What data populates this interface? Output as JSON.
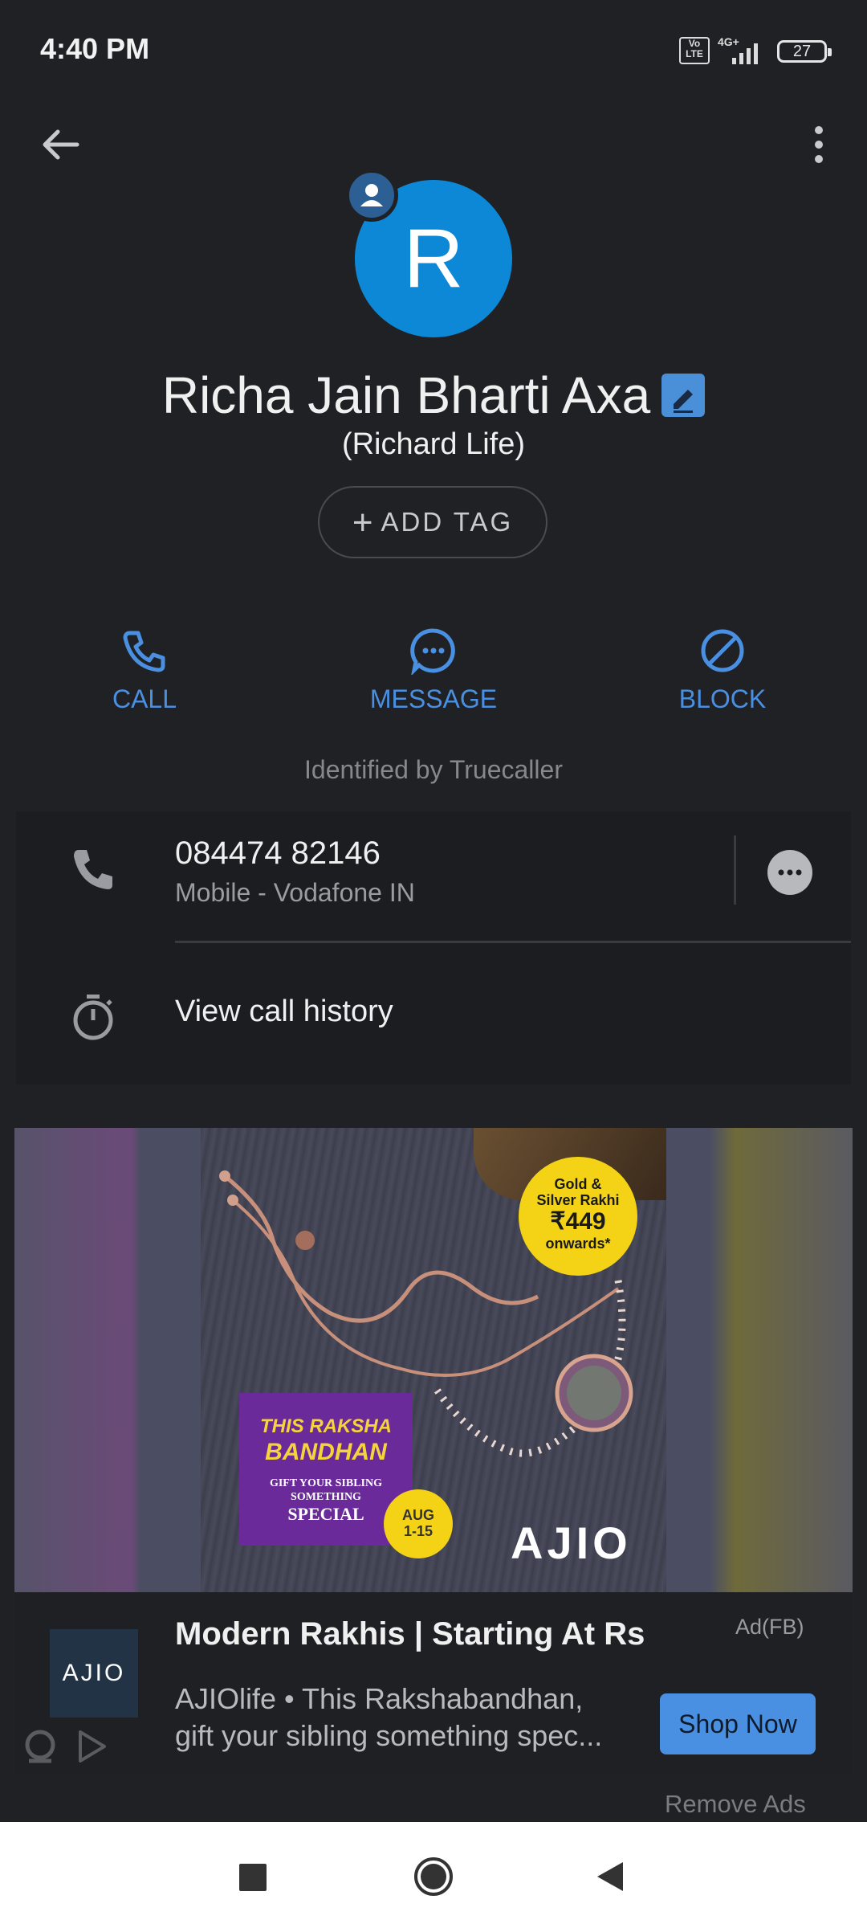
{
  "status_bar": {
    "time": "4:40 PM",
    "volte": "Vo LTE",
    "network": "4G+",
    "battery": "27"
  },
  "contact": {
    "avatar_letter": "R",
    "name": "Richa Jain Bharti Axa",
    "subtitle": "(Richard Life)",
    "add_tag_label": "ADD TAG",
    "identified_by": "Identified by Truecaller"
  },
  "actions": {
    "call": "CALL",
    "message": "MESSAGE",
    "block": "BLOCK"
  },
  "details": {
    "phone_number": "084474 82146",
    "phone_type": "Mobile - Vodafone IN",
    "call_history_label": "View call history"
  },
  "ad": {
    "image": {
      "badge_line1": "Gold &",
      "badge_line2": "Silver Rakhi",
      "badge_price": "₹449",
      "badge_line3": "onwards*",
      "promo_title_1": "THIS RAKSHA",
      "promo_title_2": "BANDHAN",
      "promo_sub_1": "GIFT YOUR SIBLING",
      "promo_sub_2": "SOMETHING",
      "promo_sub_3": "SPECIAL",
      "date_badge_1": "AUG",
      "date_badge_2": "1-15",
      "brand_overlay": "AJIO"
    },
    "logo_text": "AJIO",
    "title": "Modern Rakhis | Starting At Rs",
    "label": "Ad(FB)",
    "body_line1": "AJIOlife • This Rakshabandhan,",
    "body_line2": "gift your sibling something spec...",
    "cta": "Shop Now",
    "remove_ads": "Remove Ads"
  },
  "colors": {
    "accent": "#4a90e2",
    "avatar": "#0d88d6",
    "background": "#202125"
  }
}
